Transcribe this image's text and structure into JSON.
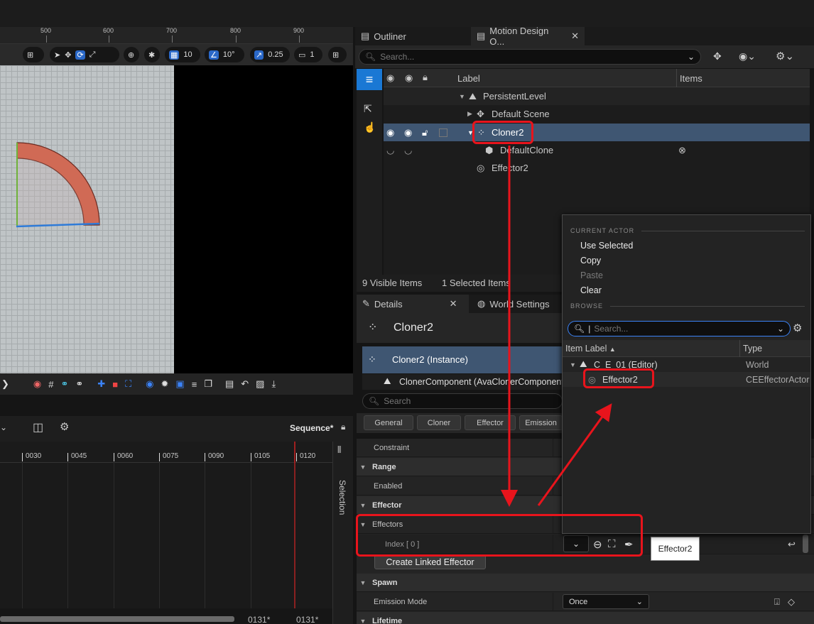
{
  "viewport": {
    "ruler_ticks": [
      "500",
      "600",
      "700",
      "800",
      "900"
    ],
    "toolbar": {
      "grid_value": "10",
      "angle_value": "10°",
      "scale_value": "0.25",
      "camera_value": "1"
    }
  },
  "sequencer": {
    "sequence_name": "Sequence*",
    "ticks": [
      "0030",
      "0045",
      "0060",
      "0075",
      "0090",
      "0105",
      "0120"
    ],
    "side_label": "Selection",
    "footer_left": "0131*",
    "footer_right": "0131*"
  },
  "outliner": {
    "tabs": [
      {
        "label": "Outliner",
        "icon": "outliner-icon"
      },
      {
        "label": "Motion Design O...",
        "icon": "outliner-icon"
      }
    ],
    "search_placeholder": "Search...",
    "columns": {
      "label": "Label",
      "items": "Items"
    },
    "rows": [
      {
        "label": "PersistentLevel",
        "icon": "level-icon"
      },
      {
        "label": "Default Scene",
        "icon": "scene-icon"
      },
      {
        "label": "Cloner2",
        "icon": "cloner-icon",
        "selected": true
      },
      {
        "label": "DefaultClone",
        "icon": "mesh-icon"
      },
      {
        "label": "Effector2",
        "icon": "effector-icon"
      }
    ],
    "status": {
      "visible": "9  Visible Items",
      "selected": "1  Selected Items"
    }
  },
  "details": {
    "tabs": [
      {
        "label": "Details",
        "icon": "pencil-icon"
      },
      {
        "label": "World Settings",
        "icon": "globe-icon"
      }
    ],
    "actor_title": "Cloner2",
    "instance_label": "Cloner2 (Instance)",
    "component_label": "ClonerComponent (AvaClonerComponent)",
    "search_placeholder": "Search",
    "categories": [
      "General",
      "Cloner",
      "Effector",
      "Emission"
    ],
    "properties": [
      {
        "label": "Constraint",
        "type": "row"
      },
      {
        "label": "Range",
        "type": "section"
      },
      {
        "label": "Enabled",
        "type": "row"
      },
      {
        "label": "Effector",
        "type": "section"
      },
      {
        "label": "Effectors",
        "type": "subsection"
      },
      {
        "label": "Index [ 0 ]",
        "type": "index"
      },
      {
        "label": "Create Linked Effector",
        "type": "button"
      },
      {
        "label": "Spawn",
        "type": "section"
      },
      {
        "label": "Emission Mode",
        "type": "row",
        "value": "Once"
      },
      {
        "label": "Lifetime",
        "type": "section"
      }
    ]
  },
  "picker_popup": {
    "current_actor_header": "CURRENT ACTOR",
    "actions": [
      {
        "label": "Use Selected",
        "enabled": true
      },
      {
        "label": "Copy",
        "enabled": true
      },
      {
        "label": "Paste",
        "enabled": false
      },
      {
        "label": "Clear",
        "enabled": true
      }
    ],
    "browse_header": "BROWSE",
    "search_placeholder": "Search...",
    "columns": {
      "label": "Item Label",
      "type": "Type"
    },
    "rows": [
      {
        "label": "C_E_01 (Editor)",
        "type": "World"
      },
      {
        "label": "Effector2",
        "type": "CEEffectorActor"
      }
    ]
  },
  "tooltip": "Effector2",
  "colors": {
    "highlight": "#e8141c",
    "selection": "#3f5672",
    "accent": "#1a78d4"
  }
}
